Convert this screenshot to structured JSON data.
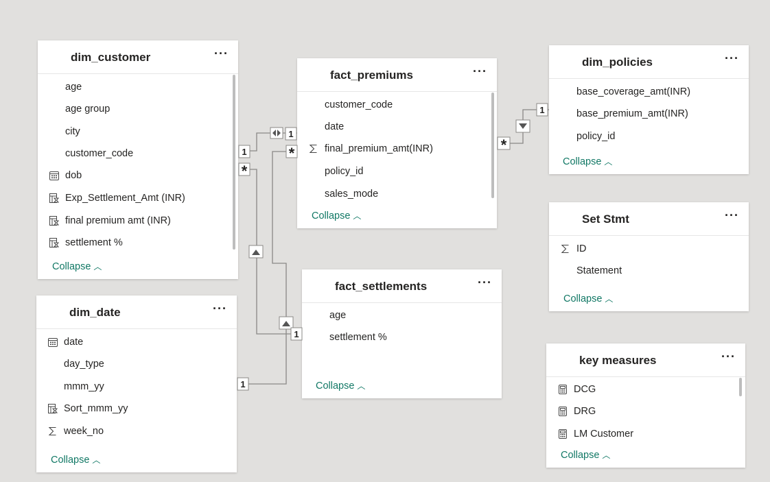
{
  "tables": {
    "dim_customer": {
      "title": "dim_customer",
      "more": "···",
      "rows": [
        {
          "label": "age",
          "icon": ""
        },
        {
          "label": "age group",
          "icon": ""
        },
        {
          "label": "city",
          "icon": ""
        },
        {
          "label": "customer_code",
          "icon": ""
        },
        {
          "label": "dob",
          "icon": "calendar-icon"
        },
        {
          "label": "Exp_Settlement_Amt (INR)",
          "icon": "calculated-column-icon"
        },
        {
          "label": "final premium amt (INR)",
          "icon": "calculated-column-icon"
        },
        {
          "label": "settlement %",
          "icon": "calculated-column-icon"
        }
      ],
      "collapse": "Collapse"
    },
    "fact_premiums": {
      "title": "fact_premiums",
      "more": "···",
      "rows": [
        {
          "label": "customer_code",
          "icon": ""
        },
        {
          "label": "date",
          "icon": ""
        },
        {
          "label": "final_premium_amt(INR)",
          "icon": "sigma-icon"
        },
        {
          "label": "policy_id",
          "icon": ""
        },
        {
          "label": "sales_mode",
          "icon": ""
        }
      ],
      "collapse": "Collapse"
    },
    "dim_policies": {
      "title": "dim_policies",
      "more": "···",
      "rows": [
        {
          "label": "base_coverage_amt(INR)",
          "icon": ""
        },
        {
          "label": "base_premium_amt(INR)",
          "icon": ""
        },
        {
          "label": "policy_id",
          "icon": ""
        }
      ],
      "collapse": "Collapse"
    },
    "set_stmt": {
      "title": "Set Stmt",
      "more": "···",
      "rows": [
        {
          "label": "ID",
          "icon": "sigma-icon"
        },
        {
          "label": "Statement",
          "icon": ""
        }
      ],
      "collapse": "Collapse"
    },
    "fact_settlements": {
      "title": "fact_settlements",
      "more": "···",
      "rows": [
        {
          "label": "age",
          "icon": ""
        },
        {
          "label": "settlement %",
          "icon": ""
        }
      ],
      "collapse": "Collapse"
    },
    "dim_date": {
      "title": "dim_date",
      "more": "···",
      "rows": [
        {
          "label": "date",
          "icon": "calendar-icon"
        },
        {
          "label": "day_type",
          "icon": ""
        },
        {
          "label": "mmm_yy",
          "icon": ""
        },
        {
          "label": "Sort_mmm_yy",
          "icon": "calculated-column-icon"
        },
        {
          "label": "week_no",
          "icon": "sigma-icon"
        }
      ],
      "collapse": "Collapse"
    },
    "key_measures": {
      "title": "key measures",
      "more": "···",
      "rows": [
        {
          "label": "DCG",
          "icon": "calculator-icon"
        },
        {
          "label": "DRG",
          "icon": "calculator-icon"
        },
        {
          "label": "LM Customer",
          "icon": "calculator-icon"
        }
      ],
      "collapse": "Collapse"
    }
  },
  "relationships": {
    "one": "1",
    "many": "*"
  },
  "colors": {
    "canvas": "#e1e0de",
    "line": "#8a8886",
    "collapse_text": "#117865"
  }
}
